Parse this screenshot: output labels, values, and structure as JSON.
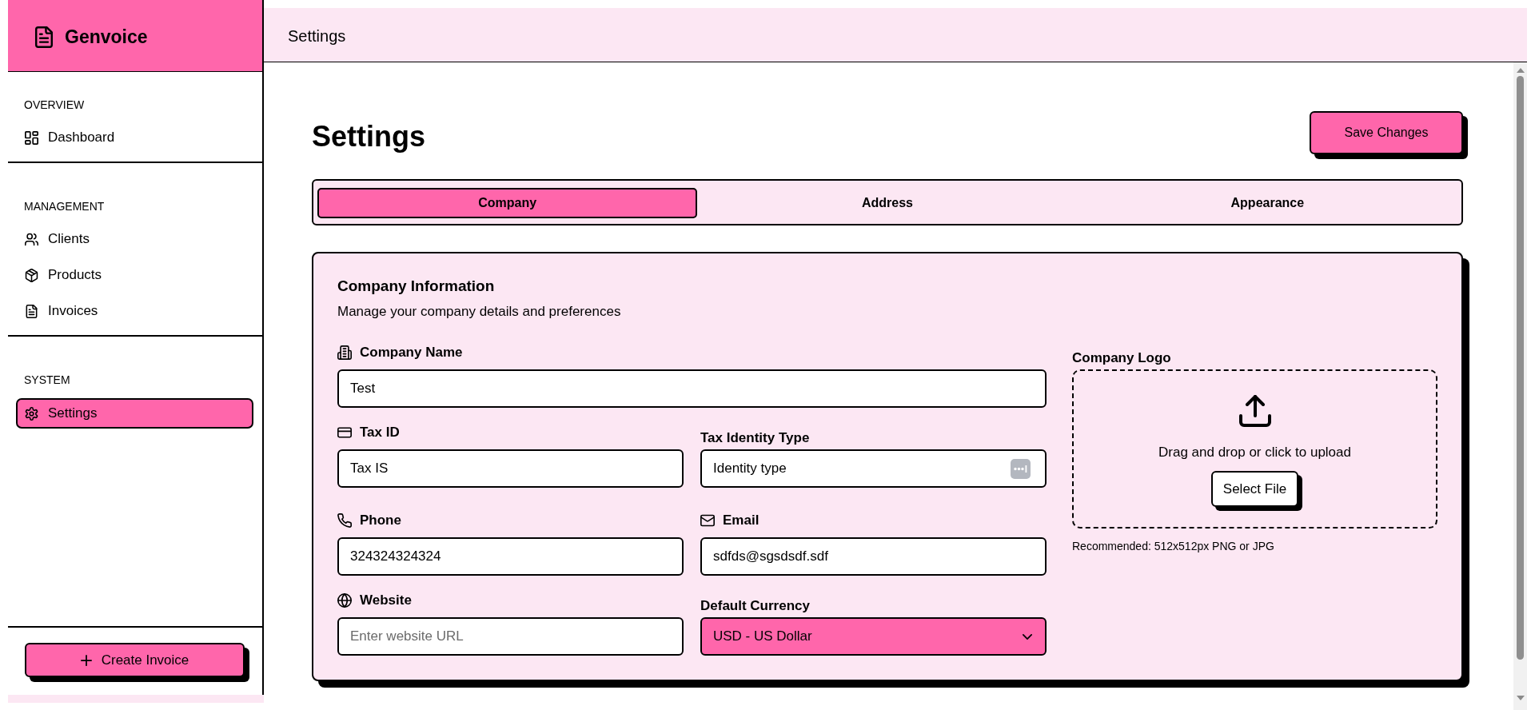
{
  "sidebar": {
    "brand": "Genvoice",
    "sections": [
      {
        "heading": "OVERVIEW",
        "items": [
          {
            "label": "Dashboard",
            "selected": false
          }
        ]
      },
      {
        "heading": "MANAGEMENT",
        "items": [
          {
            "label": "Clients",
            "selected": false
          },
          {
            "label": "Products",
            "selected": false
          },
          {
            "label": "Invoices",
            "selected": false
          }
        ]
      },
      {
        "heading": "SYSTEM",
        "items": [
          {
            "label": "Settings",
            "selected": true
          }
        ]
      }
    ],
    "create_button": "Create Invoice"
  },
  "header": {
    "title": "Settings"
  },
  "page": {
    "title": "Settings",
    "save_button": "Save Changes"
  },
  "tabs": [
    {
      "label": "Company",
      "selected": true
    },
    {
      "label": "Address",
      "selected": false
    },
    {
      "label": "Appearance",
      "selected": false
    }
  ],
  "company_card": {
    "title": "Company Information",
    "subtitle": "Manage your company details and preferences",
    "fields": [
      {
        "label": "Company Name",
        "kind": "input",
        "value": "Test"
      },
      {
        "label": "Tax ID",
        "kind": "input",
        "value": "Tax IS"
      },
      {
        "label": "Tax Identity Type",
        "kind": "picker",
        "value": "Identity type"
      },
      {
        "label": "Phone",
        "kind": "input",
        "value": "324324324324"
      },
      {
        "label": "Email",
        "kind": "input",
        "value": "sdfds@sgsdsdf.sdf"
      },
      {
        "label": "Website",
        "kind": "input",
        "placeholder": "Enter website URL"
      },
      {
        "label": "Default Currency",
        "kind": "select",
        "value": "USD - US Dollar"
      }
    ],
    "logo": {
      "label": "Company Logo",
      "prompt": "Drag and drop or click to upload",
      "button": "Select File",
      "hint": "Recommended: 512x512px PNG or JPG"
    }
  }
}
